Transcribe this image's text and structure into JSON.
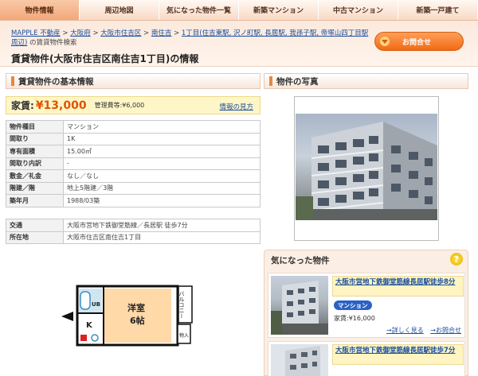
{
  "nav": {
    "tabs": [
      "物件情報",
      "周辺地図",
      "気になった物件一覧",
      "新築マンション",
      "中古マンション",
      "新築一戸建て"
    ]
  },
  "breadcrumb": {
    "items": [
      "MAPPLE 不動産",
      "大阪府",
      "大阪市住吉区",
      "南住吉",
      "1丁目(住吉東駅, 沢ノ町駅, 長居駅, 我孫子駅, 帝塚山四丁目駅周辺)"
    ],
    "separator": ">",
    "suffix": "の賃貸物件検索"
  },
  "page_title": "賃貸物件(大阪市住吉区南住吉1丁目)の情報",
  "inquiry_button": "お問合せ",
  "sections": {
    "basic_info": "賃貸物件の基本情報",
    "photo": "物件の写真",
    "favorites": "気になった物件"
  },
  "rent": {
    "label": "家賃:",
    "value": "¥13,000",
    "mgmt_label": "管理費等:",
    "mgmt_value": "¥6,000",
    "info_link": "情報の見方"
  },
  "spec_table": [
    {
      "key": "物件種目",
      "value": "マンション"
    },
    {
      "key": "間取り",
      "value": "1K"
    },
    {
      "key": "専有面積",
      "value": "15.00㎡"
    },
    {
      "key": "間取り内訳",
      "value": "-"
    },
    {
      "key": "敷金／礼金",
      "value": "なし／なし"
    },
    {
      "key": "階建／階",
      "value": "地上5階建／3階"
    },
    {
      "key": "築年月",
      "value": "1988/03築"
    }
  ],
  "access_table": [
    {
      "key": "交通",
      "value": "大阪市営地下鉄御堂筋線／長居駅 徒歩7分"
    },
    {
      "key": "所在地",
      "value": "大阪市住吉区南住吉1丁目"
    }
  ],
  "floorplan": {
    "room": "洋室",
    "size": "6帖",
    "kitchen": "K",
    "bath": "UB",
    "balcony": "バルコニー",
    "storage": "物入"
  },
  "favorites": [
    {
      "title": "大阪市営地下鉄御堂筋線長居駅徒歩8分",
      "badge": "マンション",
      "rent_label": "家賃:",
      "rent": "¥16,000",
      "detail_link": "→詳しく見る",
      "inquiry_link": "→お問合せ"
    },
    {
      "title": "大阪市営地下鉄御堂筋線長居駅徒歩7分"
    }
  ],
  "help_icon": "?",
  "colors": {
    "accent": "#f16b14",
    "rent": "#e05300",
    "link": "#1a4fa0",
    "badge": "#2a62c6"
  }
}
